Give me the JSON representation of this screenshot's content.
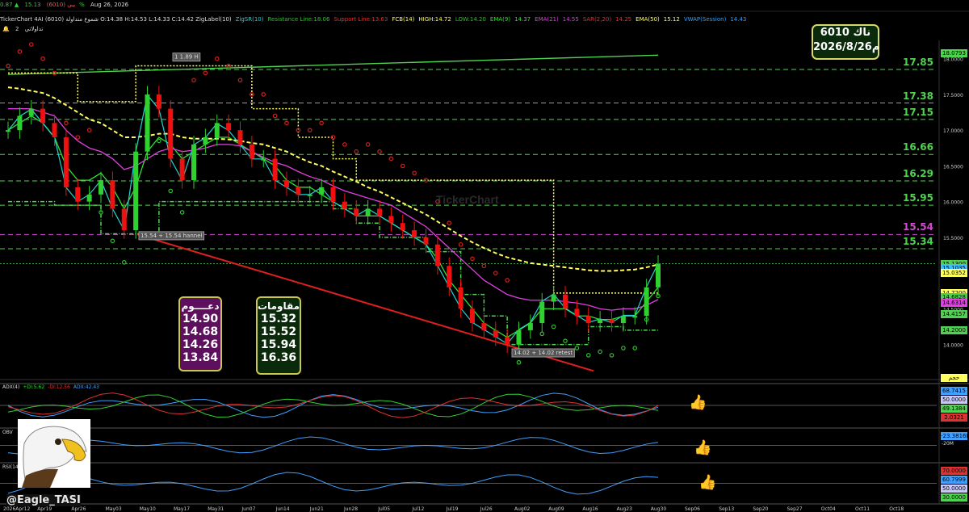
{
  "header": {
    "symbol": "يبي (6010)",
    "price": "15.13",
    "change_pct": "0.87%",
    "date": "Aug 26, 2026",
    "line2": "TickerChart 4AI (6010) شموع متداولة O:14.38 H:14.53 L:14.33 C:14.42 ZigLabel(10)",
    "indicators": [
      {
        "text": "ZigSR(10)",
        "color": "#23d3d3"
      },
      {
        "text": "Resistance Line:18.06",
        "color": "#30c030"
      },
      {
        "text": "Support Line:13.63",
        "color": "#e03030"
      },
      {
        "text": "FCB(14)",
        "color": "#ffff60"
      },
      {
        "text": "HIGH:14.72",
        "color": "#ffff60"
      },
      {
        "text": "LOW:14.20",
        "color": "#30c030"
      },
      {
        "text": "EMA(9)",
        "color": "#30e030"
      },
      {
        "text": "14.37",
        "color": "#30e030"
      },
      {
        "text": "EMA(21)",
        "color": "#e040e0"
      },
      {
        "text": "14.55",
        "color": "#e040e0"
      },
      {
        "text": "SAR(2,20)",
        "color": "#e03030"
      },
      {
        "text": "14.25",
        "color": "#e03030"
      },
      {
        "text": "EMA(50)",
        "color": "#ffff60"
      },
      {
        "text": "15.12",
        "color": "#ffff60"
      },
      {
        "text": "VWAP(Session)",
        "color": "#30a0ff"
      },
      {
        "text": "14.43",
        "color": "#30a0ff"
      }
    ],
    "alert_count": "2",
    "tab_label": "تداولاتي"
  },
  "ticker_box": {
    "line1": "ناك 6010",
    "line2": "2026/8/26م"
  },
  "support_box": {
    "title": "دعــــوم",
    "values": [
      "14.90",
      "14.68",
      "14.26",
      "13.84"
    ]
  },
  "resist_box": {
    "title": "مقاومات",
    "values": [
      "15.32",
      "15.52",
      "15.94",
      "16.36"
    ]
  },
  "levels": [
    {
      "label": "17.85",
      "value": 17.85,
      "color": "#4fd24f"
    },
    {
      "label": "17.38",
      "value": 17.38,
      "color": "#4fd24f"
    },
    {
      "label": "17.15",
      "value": 17.15,
      "color": "#4fd24f"
    },
    {
      "label": "16.66",
      "value": 16.66,
      "color": "#4fd24f"
    },
    {
      "label": "16.29",
      "value": 16.29,
      "color": "#4fd24f"
    },
    {
      "label": "15.95",
      "value": 15.95,
      "color": "#4fd24f"
    },
    {
      "label": "15.54",
      "value": 15.54,
      "color": "#d04ad0"
    },
    {
      "label": "15.34",
      "value": 15.34,
      "color": "#4fd24f"
    }
  ],
  "price_tags": [
    {
      "text": "18.0793",
      "value": 18.08,
      "bg": "#4fd24f"
    },
    {
      "text": "15.1300",
      "value": 15.13,
      "bg": "#4fd24f"
    },
    {
      "text": "15.1035",
      "value": 15.07,
      "bg": "#40c0ff"
    },
    {
      "text": "15.0352",
      "value": 15.0,
      "bg": "#ffff60"
    },
    {
      "text": "14.7200",
      "value": 14.72,
      "bg": "#ffff60"
    },
    {
      "text": "14.6828",
      "value": 14.66,
      "bg": "#4fd24f"
    },
    {
      "text": "14.6314",
      "value": 14.58,
      "bg": "#e040e0"
    },
    {
      "text": "14.4157",
      "value": 14.43,
      "bg": "#4fd24f"
    },
    {
      "text": "14.2000",
      "value": 14.2,
      "bg": "#4fd24f"
    }
  ],
  "axis_labels": [
    "18.0000",
    "17.5000",
    "17.0000",
    "16.5000",
    "16.0000",
    "15.5000",
    "15.0000",
    "14.5000",
    "14.0000"
  ],
  "axis_unit_label": "حجم",
  "zig_labels": [
    {
      "text": "1 1.89 H",
      "x_date": "May10",
      "value": 18.0
    },
    {
      "text": "15.54 + 15.54 hannel",
      "x_date": "May03",
      "value": 15.5
    },
    {
      "text": "14.02 + 14.02 retest",
      "x_date": "Jul26",
      "value": 13.86
    }
  ],
  "indicator_panels": [
    {
      "name": "adx",
      "labels": [
        {
          "text": "ADX(4)",
          "color": "#ddd"
        },
        {
          "text": "+DI:5.62",
          "color": "#30d030"
        },
        {
          "text": "-DI:12.56",
          "color": "#e03030"
        },
        {
          "text": "ADX:42.43",
          "color": "#40a0ff"
        }
      ],
      "tags": [
        {
          "text": "68.7415",
          "bg": "#40a0ff"
        },
        {
          "text": "50.0000",
          "bg": "#c8c8ff"
        },
        {
          "text": "49.1384",
          "bg": "#4fd24f"
        },
        {
          "text": "2.0321",
          "bg": "#e03030"
        }
      ]
    },
    {
      "name": "obv",
      "labels": [
        {
          "text": "OBV",
          "color": "#ddd"
        }
      ],
      "tags": [
        {
          "text": "-23.3816M",
          "bg": "#40a0ff"
        }
      ],
      "axis": "-20M"
    },
    {
      "name": "rsi",
      "labels": [
        {
          "text": "RSI(14)",
          "color": "#ddd"
        }
      ],
      "tags": [
        {
          "text": "70.0000",
          "bg": "#e03030"
        },
        {
          "text": "60.7999",
          "bg": "#40a0ff"
        },
        {
          "text": "50.0000",
          "bg": "#c8c8ff"
        },
        {
          "text": "30.0000",
          "bg": "#4fd24f"
        }
      ]
    }
  ],
  "watermark": "TickerChart",
  "handle": "@Eagle_TASI",
  "icons": {
    "thumbs": "thumbs-up-icon",
    "bell": "bell-icon",
    "eagle": "eagle-logo"
  },
  "chart_data": {
    "type": "candlestick",
    "title": "",
    "x_dates": [
      "2026Apr12",
      "Apr19",
      "Apr26",
      "May03",
      "May10",
      "May17",
      "May31",
      "Jun07",
      "Jun14",
      "Jun21",
      "Jun28",
      "Jul05",
      "Jul12",
      "Jul19",
      "Jul26",
      "Aug02",
      "Aug09",
      "Aug16",
      "Aug23",
      "Aug30",
      "Sep06",
      "Sep13",
      "Sep20",
      "Sep27",
      "Oct04",
      "Oct11",
      "Oct18"
    ],
    "ylim": [
      13.6,
      18.2
    ],
    "close": [
      17.0,
      17.2,
      17.3,
      17.1,
      16.9,
      16.2,
      16.0,
      16.1,
      16.3,
      15.9,
      15.6,
      16.7,
      17.5,
      17.3,
      16.6,
      16.3,
      16.8,
      16.9,
      17.1,
      17.0,
      16.8,
      16.6,
      16.6,
      16.3,
      16.2,
      16.1,
      16.1,
      16.2,
      16.0,
      15.9,
      15.8,
      15.9,
      15.8,
      15.7,
      15.6,
      15.5,
      15.4,
      15.1,
      14.8,
      14.5,
      14.3,
      14.2,
      14.1,
      14.0,
      14.2,
      14.3,
      14.6,
      14.7,
      14.5,
      14.4,
      14.3,
      14.35,
      14.3,
      14.4,
      14.4,
      14.8,
      15.13
    ],
    "series": [
      {
        "name": "EMA(9)",
        "color": "#30e030",
        "values": [
          17.0,
          17.1,
          17.2,
          17.1,
          16.9,
          16.5,
          16.3,
          16.3,
          16.4,
          16.2,
          15.9,
          16.2,
          16.7,
          16.9,
          16.8,
          16.6,
          16.7,
          16.8,
          16.9,
          16.9,
          16.8,
          16.7,
          16.6,
          16.5,
          16.3,
          16.2,
          16.2,
          16.1,
          16.0,
          15.9,
          15.8,
          15.8,
          15.8,
          15.7,
          15.6,
          15.5,
          15.4,
          15.2,
          14.9,
          14.7,
          14.5,
          14.3,
          14.2,
          14.1,
          14.2,
          14.3,
          14.5,
          14.5,
          14.5,
          14.4,
          14.4,
          14.35,
          14.35,
          14.4,
          14.4,
          14.6,
          14.8
        ]
      },
      {
        "name": "EMA(21)",
        "color": "#e040e0",
        "values": [
          17.3,
          17.3,
          17.3,
          17.25,
          17.2,
          17.0,
          16.85,
          16.75,
          16.7,
          16.6,
          16.45,
          16.5,
          16.6,
          16.7,
          16.75,
          16.7,
          16.72,
          16.75,
          16.8,
          16.8,
          16.78,
          16.7,
          16.62,
          16.55,
          16.5,
          16.42,
          16.35,
          16.3,
          16.22,
          16.15,
          16.1,
          16.05,
          16.0,
          15.95,
          15.85,
          15.75,
          15.65,
          15.5,
          15.35,
          15.2,
          15.05,
          14.9,
          14.8,
          14.7,
          14.65,
          14.62,
          14.62,
          14.62,
          14.6,
          14.58,
          14.55,
          14.5,
          14.48,
          14.5,
          14.5,
          14.55,
          14.63
        ]
      },
      {
        "name": "EMA(50)",
        "color": "#ffff60",
        "values": [
          17.6,
          17.58,
          17.55,
          17.52,
          17.45,
          17.35,
          17.25,
          17.15,
          17.1,
          17.0,
          16.9,
          16.9,
          16.92,
          16.95,
          16.95,
          16.9,
          16.88,
          16.88,
          16.88,
          16.87,
          16.85,
          16.82,
          16.8,
          16.75,
          16.7,
          16.62,
          16.55,
          16.5,
          16.42,
          16.35,
          16.28,
          16.2,
          16.14,
          16.06,
          15.98,
          15.9,
          15.82,
          15.72,
          15.62,
          15.52,
          15.43,
          15.35,
          15.28,
          15.22,
          15.18,
          15.14,
          15.12,
          15.1,
          15.08,
          15.06,
          15.04,
          15.03,
          15.03,
          15.04,
          15.05,
          15.08,
          15.12
        ]
      }
    ]
  }
}
